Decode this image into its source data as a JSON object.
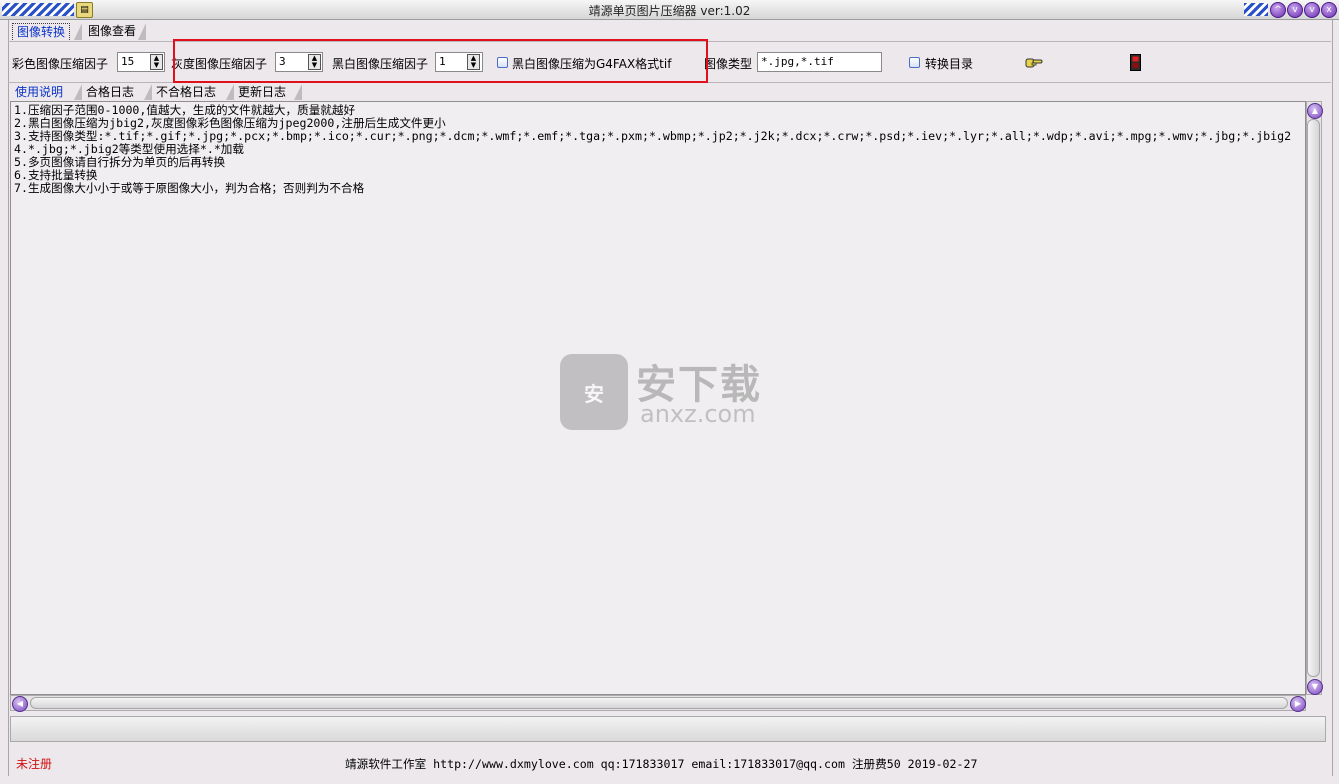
{
  "window": {
    "title": "靖源单页图片压缩器 ver:1.02",
    "controls": [
      "^",
      "v",
      "v",
      "x"
    ]
  },
  "tabs": {
    "top": [
      "图像转换",
      "图像查看"
    ],
    "active_top": "图像转换",
    "sub": [
      "使用说明",
      "合格日志",
      "不合格日志",
      "更新日志"
    ],
    "active_sub": "使用说明"
  },
  "toolbar": {
    "color_factor_label": "彩色图像压缩因子",
    "color_factor_value": "15",
    "gray_factor_label": "灰度图像压缩因子",
    "gray_factor_value": "3",
    "bw_factor_label": "黑白图像压缩因子",
    "bw_factor_value": "1",
    "g4fax_label": "黑白图像压缩为G4FAX格式tif",
    "g4fax_checked": false,
    "image_type_label": "图像类型",
    "image_type_value": "*.jpg,*.tif",
    "convert_dir_label": "转换目录",
    "convert_dir_checked": false,
    "start_icon": "pointing-hand-icon",
    "stop_icon": "exit-door-icon"
  },
  "instructions": [
    "1.压缩因子范围0-1000,值越大，生成的文件就越大，质量就越好",
    "2.黑白图像压缩为jbig2,灰度图像彩色图像压缩为jpeg2000,注册后生成文件更小",
    "3.支持图像类型:*.tif;*.gif;*.jpg;*.pcx;*.bmp;*.ico;*.cur;*.png;*.dcm;*.wmf;*.emf;*.tga;*.pxm;*.wbmp;*.jp2;*.j2k;*.dcx;*.crw;*.psd;*.iev;*.lyr;*.all;*.wdp;*.avi;*.mpg;*.wmv;*.jbg;*.jbig2",
    "4.*.jbg;*.jbig2等类型使用选择*.*加载",
    "5.多页图像请自行拆分为单页的后再转换",
    "6.支持批量转换",
    "7.生成图像大小小于或等于原图像大小，判为合格；否则判为不合格"
  ],
  "watermark": {
    "badge": "安",
    "cn": "安下载",
    "en": "anxz.com"
  },
  "status": {
    "registration": "未注册",
    "footer": "靖源软件工作室 http://www.dxmylove.com qq:171833017 email:171833017@qq.com 注册费50 2019-02-27"
  },
  "colors": {
    "highlight_box": "#e0101c",
    "active_tab_text": "#0a33c8",
    "unregistered_text": "#d01010"
  }
}
